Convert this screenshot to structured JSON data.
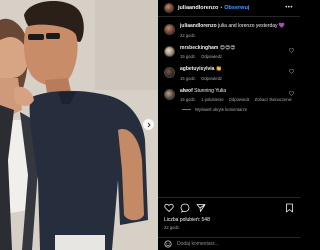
{
  "post": {
    "username": "juliaandlorenzo",
    "separator": "•",
    "follow_label": "Obserwuj"
  },
  "comments": [
    {
      "username": "juliaandlorenzo",
      "text": " julia and lorenzo yesterday 💜",
      "time": "22 godz.",
      "reply_label": "",
      "translate_label": "",
      "likes_label": ""
    },
    {
      "username": "mrsbeckingham",
      "text": " 😍😍😍",
      "time": "15 godz.",
      "reply_label": "Odpowiedz",
      "translate_label": "",
      "likes_label": ""
    },
    {
      "username": "agbetuyisylvia",
      "text": " 👏",
      "time": "15 godz.",
      "reply_label": "Odpowiedz",
      "translate_label": "",
      "likes_label": ""
    },
    {
      "username": "alwof",
      "text": " Stunning Yulia",
      "time": "15 godz.",
      "reply_label": "Odpowiedz",
      "translate_label": "Zobacz tłumaczenie",
      "likes_label": "1 polubienie"
    }
  ],
  "view_replies_label": "Wyświetl ukryte komentarze",
  "likes_text": "Liczba polubień: 548",
  "date_text": "22 godz.",
  "comment_placeholder": "Dodaj komentarz...",
  "icons": [
    "heart-icon",
    "comment-icon",
    "share-icon",
    "bookmark-icon",
    "emoji-icon",
    "more-icon",
    "chevron-right-icon"
  ],
  "colors": {
    "follow": "#4a9bff",
    "panel_bg": "#000000",
    "muted": "#a8a8a8"
  }
}
